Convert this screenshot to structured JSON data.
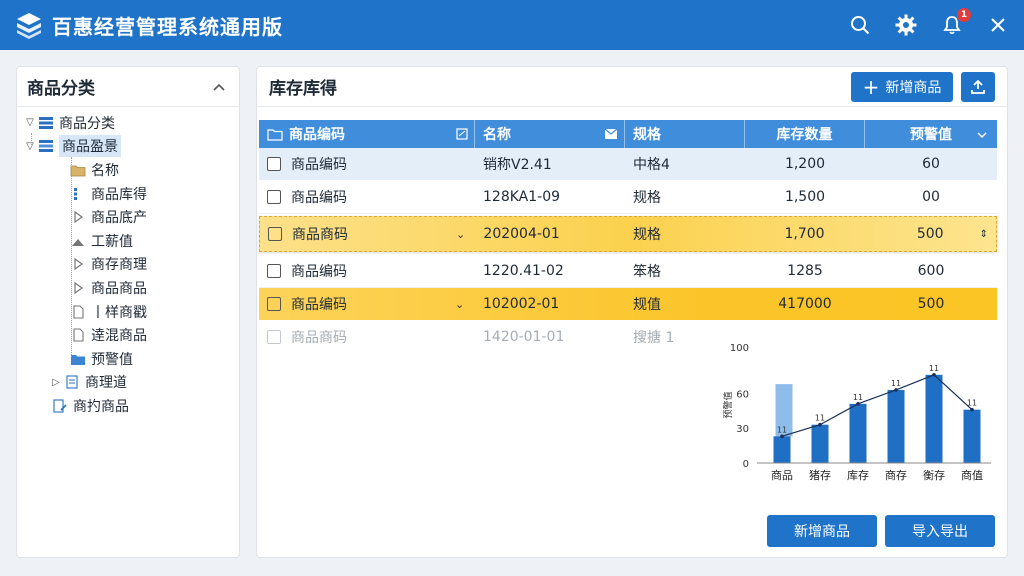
{
  "app": {
    "title": "百惠经营管理系统通用版",
    "notification_count": "1"
  },
  "sidebar": {
    "title": "商品分类",
    "items": [
      {
        "label": "商品分类"
      },
      {
        "label": "商品盈景"
      },
      {
        "label": "名称"
      },
      {
        "label": "商品库得"
      },
      {
        "label": "商品底产"
      },
      {
        "label": "工薪值"
      },
      {
        "label": "商存商理"
      },
      {
        "label": "商品商品"
      },
      {
        "label": "丨样商戳"
      },
      {
        "label": "逹混商品"
      },
      {
        "label": "预警值"
      },
      {
        "label": "商理道"
      },
      {
        "label": "商扚商品"
      }
    ]
  },
  "main": {
    "title": "库存库得",
    "add_button": "新增商品",
    "footer_add": "新增商品",
    "footer_import": "导入导出"
  },
  "table": {
    "headers": [
      "商品编码",
      "名称",
      "规格",
      "库存数量",
      "预警值"
    ],
    "rows": [
      {
        "code": "商品编码",
        "name": "销称V2.41",
        "spec": "中格4",
        "qty": "1,200",
        "warn": "60"
      },
      {
        "code": "商品编码",
        "name": "128KA1-09",
        "spec": "规格",
        "qty": "1,500",
        "warn": "00"
      },
      {
        "code": "商品商码",
        "name": "202004-01",
        "spec": "规格",
        "qty": "1,700",
        "warn": "500"
      },
      {
        "code": "商品编码",
        "name": "1220.41-02",
        "spec": "笨格",
        "qty": "1285",
        "warn": "600"
      },
      {
        "code": "商品编码",
        "name": "102002-01",
        "spec": "规值",
        "qty": "417000",
        "warn": "500"
      },
      {
        "code": "商品商码",
        "name": "1420-01-01",
        "spec": "搜搪 1",
        "qty": "",
        "warn": ""
      }
    ]
  },
  "chart_data": {
    "type": "bar",
    "categories": [
      "商品",
      "猪存",
      "库存",
      "商存",
      "衡存",
      "商值"
    ],
    "values": [
      23,
      33,
      51,
      63,
      76,
      46
    ],
    "line_values": [
      23,
      33,
      51,
      63,
      76,
      46
    ],
    "ghost_bar": {
      "category_index": 0,
      "value": 68
    },
    "data_labels": [
      "11",
      "11",
      "11",
      "11",
      "11",
      "11"
    ],
    "ylabel": "预警值",
    "yticks": [
      0,
      30,
      60,
      100
    ],
    "ylim": [
      0,
      100
    ],
    "colors": {
      "bar": "#1f6fc4",
      "ghost": "#8fbde9",
      "line": "#1a2f55"
    }
  },
  "colors": {
    "accent": "#1f74c9",
    "table_header": "#3f8ddb",
    "highlight": "#fbc52a"
  }
}
